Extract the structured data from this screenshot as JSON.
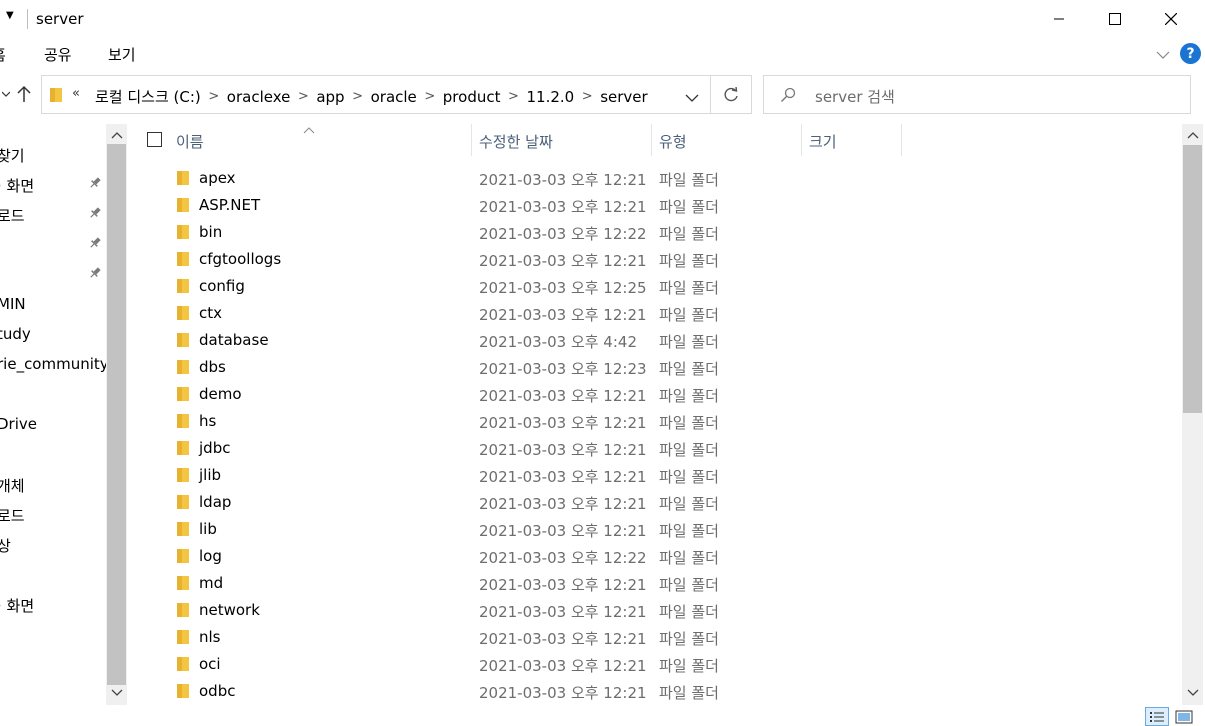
{
  "window": {
    "title": "server"
  },
  "ribbon": {
    "tabs": [
      "홈",
      "공유",
      "보기"
    ],
    "help_label": "?"
  },
  "address": {
    "more_label": "«",
    "breadcrumbs": [
      "로컬 디스크 (C:)",
      "oraclexe",
      "app",
      "oracle",
      "product",
      "11.2.0",
      "server"
    ],
    "separator": ">"
  },
  "search": {
    "placeholder": "server 검색"
  },
  "nav": {
    "items": [
      {
        "label": "찾기",
        "pinned": false
      },
      {
        "label": "· 화면",
        "pinned": true
      },
      {
        "label": "로드",
        "pinned": true
      },
      {
        "label": "",
        "pinned": true
      },
      {
        "label": "",
        "pinned": true
      },
      {
        "label": "MIN",
        "pinned": false
      },
      {
        "label": "tudy",
        "pinned": false
      },
      {
        "label": "rie_community",
        "pinned": false
      },
      {
        "label": "",
        "pinned": false
      },
      {
        "label": "Drive",
        "pinned": false
      },
      {
        "label": "",
        "pinned": false
      },
      {
        "label": "개체",
        "pinned": false
      },
      {
        "label": "로드",
        "pinned": false
      },
      {
        "label": "상",
        "pinned": false
      },
      {
        "label": "",
        "pinned": false
      },
      {
        "label": "· 화면",
        "pinned": false
      },
      {
        "label": "",
        "pinned": false
      },
      {
        "label": "",
        "pinned": false
      }
    ]
  },
  "columns": {
    "name": "이름",
    "date": "수정한 날짜",
    "type": "유형",
    "size": "크기"
  },
  "files": [
    {
      "name": "apex",
      "date": "2021-03-03 오후 12:21",
      "type": "파일 폴더"
    },
    {
      "name": "ASP.NET",
      "date": "2021-03-03 오후 12:21",
      "type": "파일 폴더"
    },
    {
      "name": "bin",
      "date": "2021-03-03 오후 12:22",
      "type": "파일 폴더"
    },
    {
      "name": "cfgtoollogs",
      "date": "2021-03-03 오후 12:21",
      "type": "파일 폴더"
    },
    {
      "name": "config",
      "date": "2021-03-03 오후 12:25",
      "type": "파일 폴더"
    },
    {
      "name": "ctx",
      "date": "2021-03-03 오후 12:21",
      "type": "파일 폴더"
    },
    {
      "name": "database",
      "date": "2021-03-03 오후 4:42",
      "type": "파일 폴더"
    },
    {
      "name": "dbs",
      "date": "2021-03-03 오후 12:23",
      "type": "파일 폴더"
    },
    {
      "name": "demo",
      "date": "2021-03-03 오후 12:21",
      "type": "파일 폴더"
    },
    {
      "name": "hs",
      "date": "2021-03-03 오후 12:21",
      "type": "파일 폴더"
    },
    {
      "name": "jdbc",
      "date": "2021-03-03 오후 12:21",
      "type": "파일 폴더"
    },
    {
      "name": "jlib",
      "date": "2021-03-03 오후 12:21",
      "type": "파일 폴더"
    },
    {
      "name": "ldap",
      "date": "2021-03-03 오후 12:21",
      "type": "파일 폴더"
    },
    {
      "name": "lib",
      "date": "2021-03-03 오후 12:21",
      "type": "파일 폴더"
    },
    {
      "name": "log",
      "date": "2021-03-03 오후 12:22",
      "type": "파일 폴더"
    },
    {
      "name": "md",
      "date": "2021-03-03 오후 12:21",
      "type": "파일 폴더"
    },
    {
      "name": "network",
      "date": "2021-03-03 오후 12:21",
      "type": "파일 폴더"
    },
    {
      "name": "nls",
      "date": "2021-03-03 오후 12:21",
      "type": "파일 폴더"
    },
    {
      "name": "oci",
      "date": "2021-03-03 오후 12:21",
      "type": "파일 폴더"
    },
    {
      "name": "odbc",
      "date": "2021-03-03 오후 12:21",
      "type": "파일 폴더"
    }
  ],
  "colors": {
    "folder": "#f4c542",
    "accent": "#1a74d2",
    "header_text": "#4c607a",
    "secondary_text": "#6d6d6d"
  }
}
